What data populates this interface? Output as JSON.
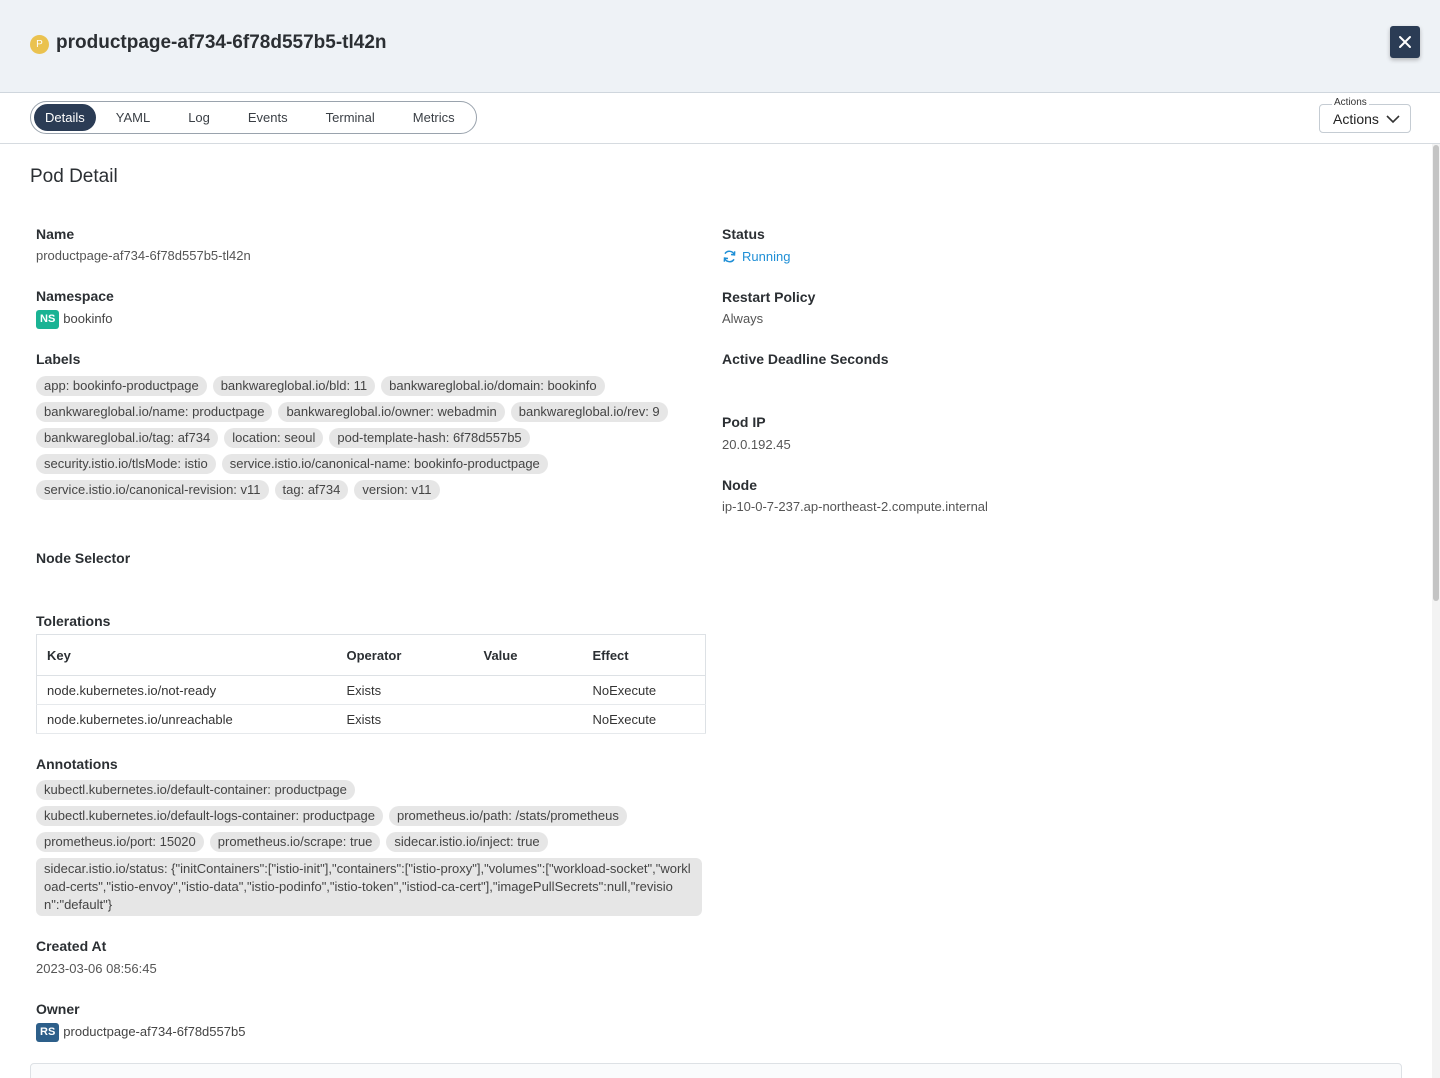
{
  "header": {
    "kind_badge": "P",
    "title": "productpage-af734-6f78d557b5-tl42n",
    "close_icon": "close-icon"
  },
  "tabs": [
    {
      "label": "Details",
      "active": true
    },
    {
      "label": "YAML",
      "active": false
    },
    {
      "label": "Log",
      "active": false
    },
    {
      "label": "Events",
      "active": false
    },
    {
      "label": "Terminal",
      "active": false
    },
    {
      "label": "Metrics",
      "active": false
    }
  ],
  "actions": {
    "legend": "Actions",
    "value": "Actions"
  },
  "detail": {
    "section_title": "Pod Detail",
    "name_label": "Name",
    "name_value": "productpage-af734-6f78d557b5-tl42n",
    "namespace_label": "Namespace",
    "namespace_badge": "NS",
    "namespace_value": "bookinfo",
    "labels_label": "Labels",
    "labels": [
      "app: bookinfo-productpage",
      "bankwareglobal.io/bld: 11",
      "bankwareglobal.io/domain: bookinfo",
      "bankwareglobal.io/name: productpage",
      "bankwareglobal.io/owner: webadmin",
      "bankwareglobal.io/rev: 9",
      "bankwareglobal.io/tag: af734",
      "location: seoul",
      "pod-template-hash: 6f78d557b5",
      "security.istio.io/tlsMode: istio",
      "service.istio.io/canonical-name: bookinfo-productpage",
      "service.istio.io/canonical-revision: v11",
      "tag: af734",
      "version: v11"
    ],
    "node_selector_label": "Node Selector",
    "tolerations_label": "Tolerations",
    "tolerations_headers": [
      "Key",
      "Operator",
      "Value",
      "Effect"
    ],
    "tolerations": [
      {
        "key": "node.kubernetes.io/not-ready",
        "operator": "Exists",
        "value": "",
        "effect": "NoExecute"
      },
      {
        "key": "node.kubernetes.io/unreachable",
        "operator": "Exists",
        "value": "",
        "effect": "NoExecute"
      }
    ],
    "annotations_label": "Annotations",
    "annotations": [
      "kubectl.kubernetes.io/default-container: productpage",
      "kubectl.kubernetes.io/default-logs-container: productpage",
      "prometheus.io/path: /stats/prometheus",
      "prometheus.io/port: 15020",
      "prometheus.io/scrape: true",
      "sidecar.istio.io/inject: true"
    ],
    "annotation_status": "sidecar.istio.io/status: {\"initContainers\":[\"istio-init\"],\"containers\":[\"istio-proxy\"],\"volumes\":[\"workload-socket\",\"workload-certs\",\"istio-envoy\",\"istio-data\",\"istio-podinfo\",\"istio-token\",\"istiod-ca-cert\"],\"imagePullSecrets\":null,\"revision\":\"default\"}",
    "created_label": "Created At",
    "created_value": "2023-03-06 08:56:45",
    "owner_label": "Owner",
    "owner_badge": "RS",
    "owner_value": "productpage-af734-6f78d557b5",
    "status_label": "Status",
    "status_value": "Running",
    "status_color": "#1f8fd6",
    "restart_label": "Restart Policy",
    "restart_value": "Always",
    "deadline_label": "Active Deadline Seconds",
    "podip_label": "Pod IP",
    "podip_value": "20.0.192.45",
    "node_label": "Node",
    "node_value": "ip-10-0-7-237.ap-northeast-2.compute.internal"
  }
}
